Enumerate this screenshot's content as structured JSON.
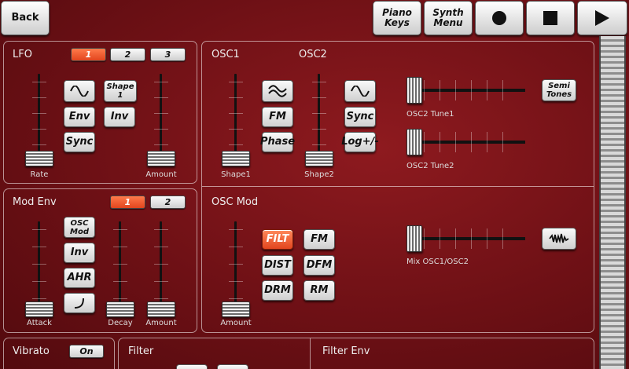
{
  "header": {
    "back_label": "Back",
    "piano_keys_label": "Piano\nKeys",
    "synth_menu_label": "Synth\nMenu"
  },
  "lfo": {
    "title": "LFO",
    "tabs": [
      "1",
      "2",
      "3"
    ],
    "buttons": {
      "shape": "Shape\n1",
      "env": "Env",
      "inv": "Inv",
      "sync": "Sync"
    },
    "labels": {
      "rate": "Rate",
      "amount": "Amount"
    },
    "values": {
      "rate": 0.0,
      "amount": 0.0
    }
  },
  "mod_env": {
    "title": "Mod Env",
    "tabs": [
      "1",
      "2"
    ],
    "buttons": {
      "osc_mod": "OSC\nMod",
      "inv": "Inv",
      "ahr": "AHR"
    },
    "labels": {
      "attack": "Attack",
      "decay": "Decay",
      "amount": "Amount"
    },
    "values": {
      "attack": 0.0,
      "decay": 0.0,
      "amount": 0.0
    }
  },
  "osc": {
    "title1": "OSC1",
    "title2": "OSC2",
    "buttons": {
      "fm": "FM",
      "phase": "Phase",
      "sync": "Sync",
      "log": "Log+/-",
      "semi_tones": "Semi\nTones"
    },
    "labels": {
      "shape1": "Shape1",
      "shape2": "Shape2",
      "tune1": "OSC2 Tune1",
      "tune2": "OSC2 Tune2"
    },
    "values": {
      "shape1": 0.0,
      "shape2": 0.0,
      "tune1": 0.0,
      "tune2": 0.0
    }
  },
  "osc_mod": {
    "title": "OSC Mod",
    "buttons": {
      "filt": "FILT",
      "fm": "FM",
      "dist": "DIST",
      "dfm": "DFM",
      "drm": "DRM",
      "rm": "RM"
    },
    "labels": {
      "amount": "Amount",
      "mix": "Mix OSC1/OSC2"
    },
    "values": {
      "amount": 0.0,
      "mix": 0.0
    }
  },
  "vibrato": {
    "title": "Vibrato",
    "toggle_label": "On"
  },
  "filter": {
    "title": "Filter"
  },
  "filter_env": {
    "title": "Filter Env"
  },
  "icons": {
    "record": "record-icon",
    "stop": "stop-icon",
    "play": "play-icon",
    "wave_sine": "sine-wave-icon",
    "wave_tri": "triangle-wave-icon",
    "wave_noise": "noise-wave-icon",
    "curve": "curve-icon"
  },
  "colors": {
    "background": "#7a1217",
    "accent": "#e2451e"
  }
}
